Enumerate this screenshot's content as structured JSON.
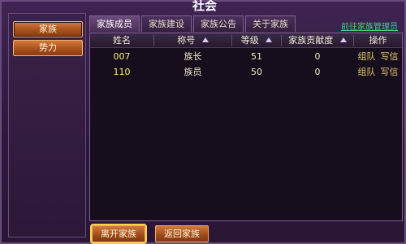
{
  "window": {
    "title": "社会"
  },
  "sidebar": {
    "items": [
      {
        "label": "家族",
        "active": true
      },
      {
        "label": "势力",
        "active": false
      }
    ]
  },
  "tabs": [
    {
      "label": "家族成员",
      "active": true
    },
    {
      "label": "家族建设",
      "active": false
    },
    {
      "label": "家族公告",
      "active": false
    },
    {
      "label": "关于家族",
      "active": false
    }
  ],
  "admin_link": "前往家族管理员",
  "table": {
    "columns": [
      "姓名",
      "称号",
      "等级",
      "家族贡献度",
      "操作"
    ],
    "rows": [
      {
        "name": "007",
        "title": "族长",
        "level": "51",
        "contribution": "0",
        "actions": [
          "组队",
          "写信"
        ]
      },
      {
        "name": "110",
        "title": "族员",
        "level": "50",
        "contribution": "0",
        "actions": [
          "组队",
          "写信"
        ]
      }
    ]
  },
  "buttons": {
    "leave_family": "离开家族",
    "return_family": "返回家族"
  },
  "colors": {
    "accent_orange": "#b75c22",
    "highlight_yellow": "#ffd24a",
    "link_green": "#42d080"
  }
}
